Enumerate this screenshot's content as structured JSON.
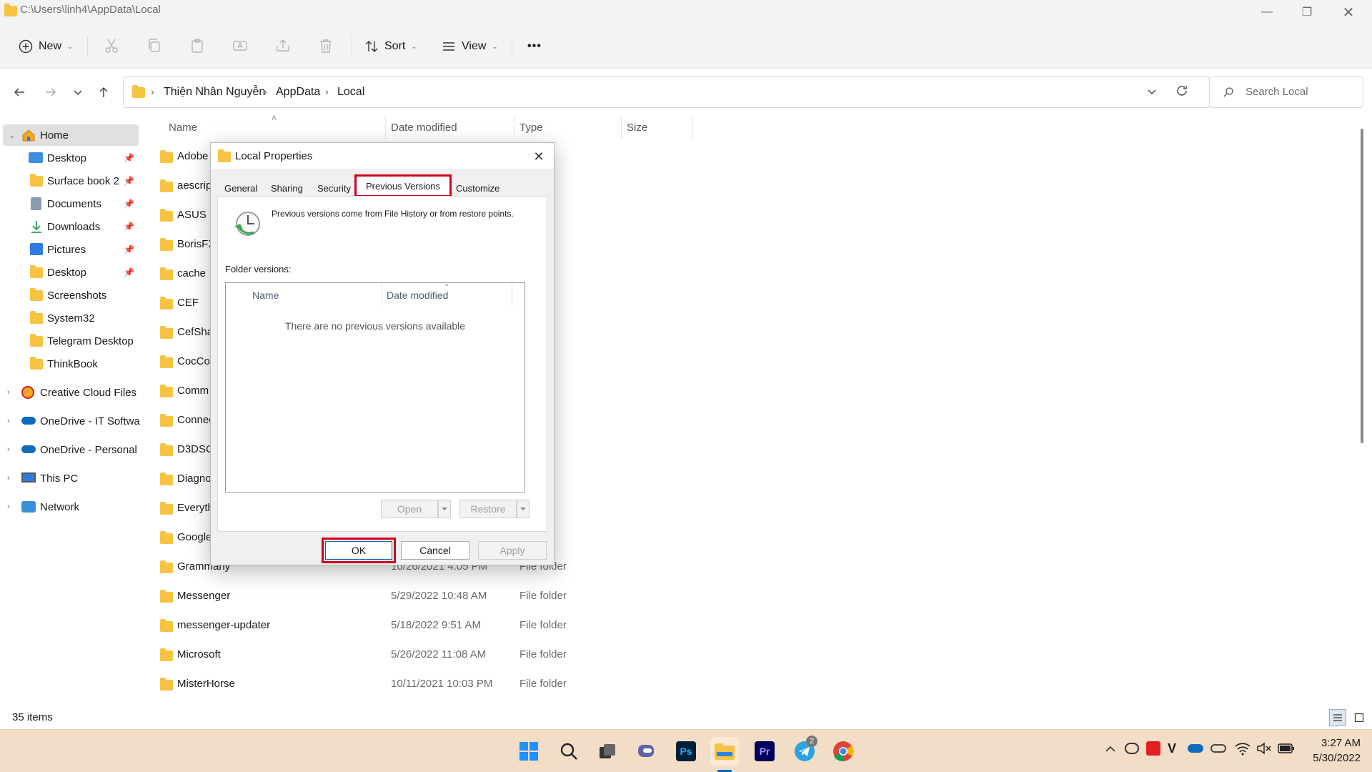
{
  "window": {
    "path": "C:\\Users\\linh4\\AppData\\Local"
  },
  "toolbar": {
    "new_label": "New",
    "sort_label": "Sort",
    "view_label": "View",
    "more_label": "•••"
  },
  "breadcrumb": [
    "Thiện Nhân Nguyễn",
    "AppData",
    "Local"
  ],
  "search": {
    "placeholder": "Search Local"
  },
  "sidebar": {
    "home": "Home",
    "items": [
      {
        "label": "Desktop",
        "pinned": true,
        "icon": "desktop-icon"
      },
      {
        "label": "Surface book 2",
        "pinned": true,
        "icon": "folder-icon"
      },
      {
        "label": "Documents",
        "pinned": true,
        "icon": "documents-icon"
      },
      {
        "label": "Downloads",
        "pinned": true,
        "icon": "download-icon"
      },
      {
        "label": "Pictures",
        "pinned": true,
        "icon": "pictures-icon"
      },
      {
        "label": "Desktop",
        "pinned": true,
        "icon": "folder-icon"
      },
      {
        "label": "Screenshots",
        "pinned": false,
        "icon": "folder-icon"
      },
      {
        "label": "System32",
        "pinned": false,
        "icon": "folder-icon"
      },
      {
        "label": "Telegram Desktop",
        "pinned": false,
        "icon": "folder-icon"
      },
      {
        "label": "ThinkBook",
        "pinned": false,
        "icon": "folder-icon"
      }
    ],
    "groups": [
      {
        "label": "Creative Cloud Files",
        "icon": "creative-cloud-icon"
      },
      {
        "label": "OneDrive - IT Softwa",
        "icon": "onedrive-icon"
      },
      {
        "label": "OneDrive - Personal",
        "icon": "onedrive-icon"
      },
      {
        "label": "This PC",
        "icon": "pc-icon"
      },
      {
        "label": "Network",
        "icon": "network-icon"
      }
    ]
  },
  "columns": {
    "name": "Name",
    "date": "Date modified",
    "type": "Type",
    "size": "Size"
  },
  "files": [
    {
      "name": "Adobe",
      "date": "",
      "type": "der"
    },
    {
      "name": "aescrip",
      "date": "",
      "type": "der"
    },
    {
      "name": "ASUS",
      "date": "",
      "type": "der"
    },
    {
      "name": "BorisFX",
      "date": "",
      "type": "der"
    },
    {
      "name": "cache",
      "date": "",
      "type": "der"
    },
    {
      "name": "CEF",
      "date": "",
      "type": "der"
    },
    {
      "name": "CefSha",
      "date": "",
      "type": "der"
    },
    {
      "name": "CocCoc",
      "date": "",
      "type": "der"
    },
    {
      "name": "Comm",
      "date": "",
      "type": "der"
    },
    {
      "name": "Connec",
      "date": "",
      "type": "der"
    },
    {
      "name": "D3DSC",
      "date": "",
      "type": "der"
    },
    {
      "name": "Diagno",
      "date": "",
      "type": "der"
    },
    {
      "name": "Everyth",
      "date": "",
      "type": "der"
    },
    {
      "name": "Google",
      "date": "",
      "type": "der"
    },
    {
      "name": "Grammarly",
      "date": "10/26/2021 4:05 PM",
      "type": "File folder"
    },
    {
      "name": "Messenger",
      "date": "5/29/2022 10:48 AM",
      "type": "File folder"
    },
    {
      "name": "messenger-updater",
      "date": "5/18/2022 9:51 AM",
      "type": "File folder"
    },
    {
      "name": "Microsoft",
      "date": "5/26/2022 11:08 AM",
      "type": "File folder"
    },
    {
      "name": "MisterHorse",
      "date": "10/11/2021 10:03 PM",
      "type": "File folder"
    }
  ],
  "status": {
    "count": "35 items"
  },
  "dialog": {
    "title": "Local Properties",
    "tabs": [
      "General",
      "Sharing",
      "Security",
      "Previous Versions",
      "Customize"
    ],
    "description": "Previous versions come from File History or from restore points.",
    "folder_versions_label": "Folder versions:",
    "list_columns": {
      "name": "Name",
      "date": "Date modified"
    },
    "empty_text": "There are no previous versions available",
    "open_label": "Open",
    "restore_label": "Restore",
    "ok_label": "OK",
    "cancel_label": "Cancel",
    "apply_label": "Apply"
  },
  "taskbar": {
    "time": "3:27 AM",
    "date": "5/30/2022",
    "telegram_badge": "2",
    "apps": [
      "windows-start",
      "search",
      "task-view",
      "teams-chat",
      "photoshop",
      "file-explorer",
      "premiere",
      "telegram",
      "chrome"
    ]
  },
  "colors": {
    "accent_highlight": "#d0021b",
    "folder": "#f6c342",
    "taskbar": "#f2dec6"
  }
}
